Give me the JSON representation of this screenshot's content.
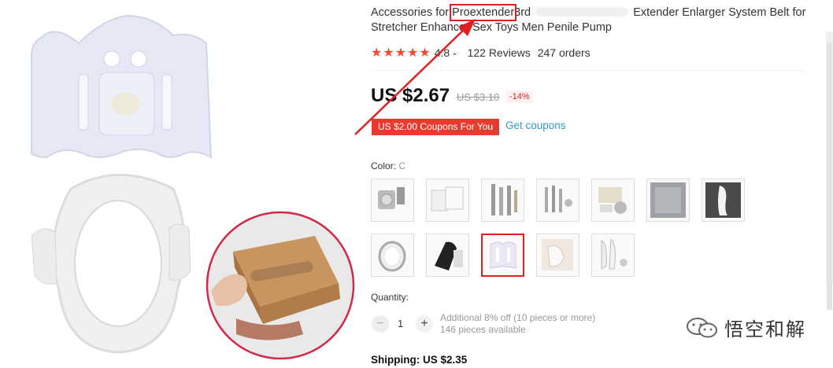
{
  "product": {
    "title_prefix": "Accessories for",
    "title_highlight": "Proextender",
    "title_mid": "3rd",
    "title_suffix": "Extender Enlarger System Belt for",
    "title_line2": "Stretcher Enhancer Sex Toys Men Penile Pump"
  },
  "rating": {
    "score": "4.8",
    "reviews": "122 Reviews",
    "orders": "247 orders",
    "stars": 5
  },
  "price": {
    "current": "US $2.67",
    "original": "US $3.10",
    "discount": "-14%"
  },
  "coupon": {
    "label": "US $2.00 Coupons For You",
    "link": "Get coupons"
  },
  "color": {
    "label": "Color:",
    "value": "C"
  },
  "quantity": {
    "label": "Quantity:",
    "value": "1",
    "minus": "−",
    "plus": "+",
    "note1": "Additional 8% off (10 pieces or more)",
    "note2": "146 pieces available"
  },
  "shipping": {
    "label": "Shipping: US $2.35"
  },
  "watermark": {
    "text": "悟空和解"
  },
  "colors": {
    "accent": "#e02020",
    "coupon": "#e83a2f",
    "link": "#2e9cc3",
    "star": "#f24a33"
  }
}
